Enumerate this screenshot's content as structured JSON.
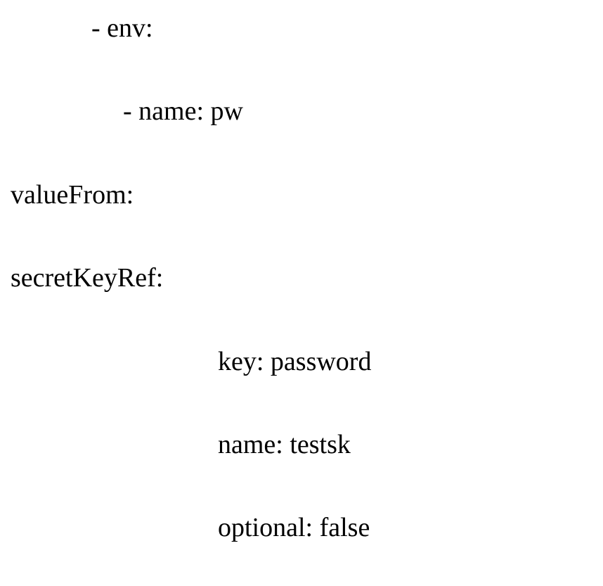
{
  "lines": {
    "l1": "- env:",
    "l2": "- name: pw",
    "l3": "valueFrom:",
    "l4": "secretKeyRef:",
    "l5": "key: password",
    "l6": "name: testsk",
    "l7": "optional: false"
  }
}
